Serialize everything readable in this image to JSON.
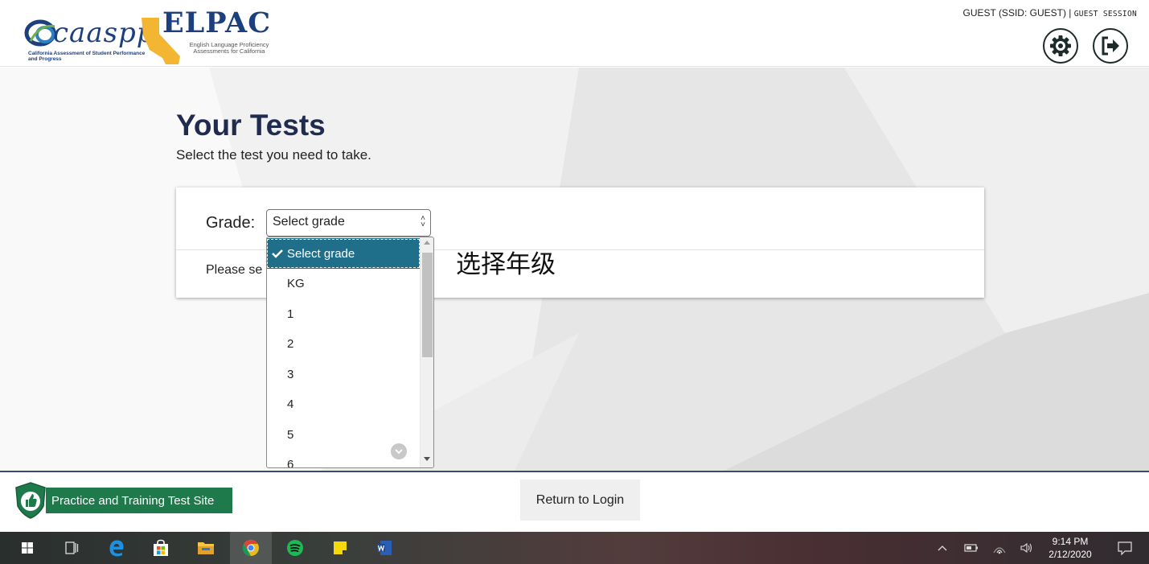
{
  "header": {
    "caaspp_logo_text": "caaspp",
    "caaspp_subtitle": "California Assessment of Student Performance and Progress",
    "elpac_logo_text": "ELPAC",
    "elpac_subtitle": "English Language Proficiency Assessments for California",
    "user_label": "GUEST (SSID: GUEST) | ",
    "session_label": "GUEST SESSION",
    "settings_icon": "gear-icon",
    "logout_icon": "logout-icon"
  },
  "main": {
    "title": "Your Tests",
    "subtitle": "Select the test you need to take.",
    "grade_label": "Grade:",
    "grade_select_value": "Select grade",
    "please_text": "Please se"
  },
  "dropdown": {
    "options": [
      "Select grade",
      "KG",
      "1",
      "2",
      "3",
      "4",
      "5",
      "6"
    ],
    "selected_index": 0
  },
  "annotation": "选择年级",
  "footer": {
    "site_badge": "Practice and Training Test Site",
    "return_button": "Return to Login"
  },
  "taskbar": {
    "time": "9:14 PM",
    "date": "2/12/2020",
    "icons": [
      "windows-start-icon",
      "task-view-icon",
      "edge-icon",
      "store-icon",
      "file-explorer-icon",
      "chrome-icon",
      "spotify-icon",
      "sticky-notes-icon",
      "word-icon"
    ],
    "colors": {
      "edge": "#1f8fe0",
      "chrome": "#e9b823",
      "spotify": "#1db954",
      "sticky": "#f5d90a",
      "word": "#2b5fb3"
    }
  }
}
